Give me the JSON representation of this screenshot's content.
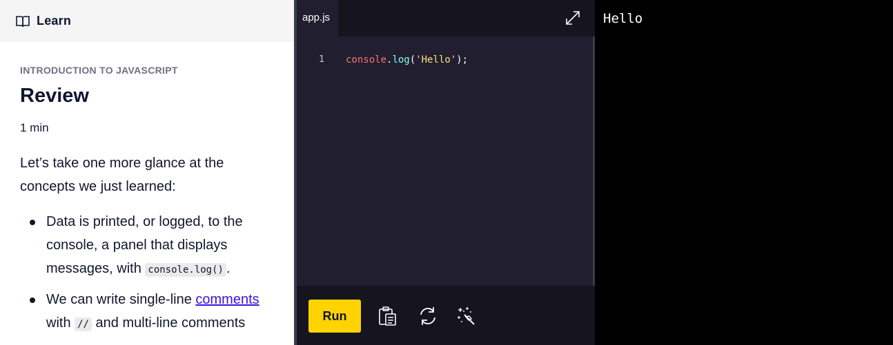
{
  "learn": {
    "header_label": "Learn",
    "course_name": "INTRODUCTION TO JAVASCRIPT",
    "lesson_title": "Review",
    "duration": "1 min",
    "intro": "Let’s take one more glance at the concepts we just learned:",
    "bullet1": {
      "text": "Data is printed, or logged, to the console, a panel that displays messages, with ",
      "code": "console.log()",
      "suffix": "."
    },
    "bullet2": {
      "text": "We can write single-line ",
      "link": "comments",
      "text2": " with ",
      "code": "//",
      "text3": " and multi-line comments"
    }
  },
  "editor": {
    "tab_label": "app.js",
    "expand_icon": "expand-icon",
    "line_number": "1",
    "code_tokens": {
      "obj": "console",
      "dot": ".",
      "fn": "log",
      "open": "(",
      "str": "'Hello'",
      "close": ");"
    },
    "run_label": "Run",
    "tools": [
      "clipboard-icon",
      "refresh-icon",
      "magic-wand-icon"
    ]
  },
  "output": {
    "text": "Hello"
  },
  "colors": {
    "run_button": "#ffd300",
    "editor_bg": "#211e2f",
    "link": "#3a10e5"
  }
}
